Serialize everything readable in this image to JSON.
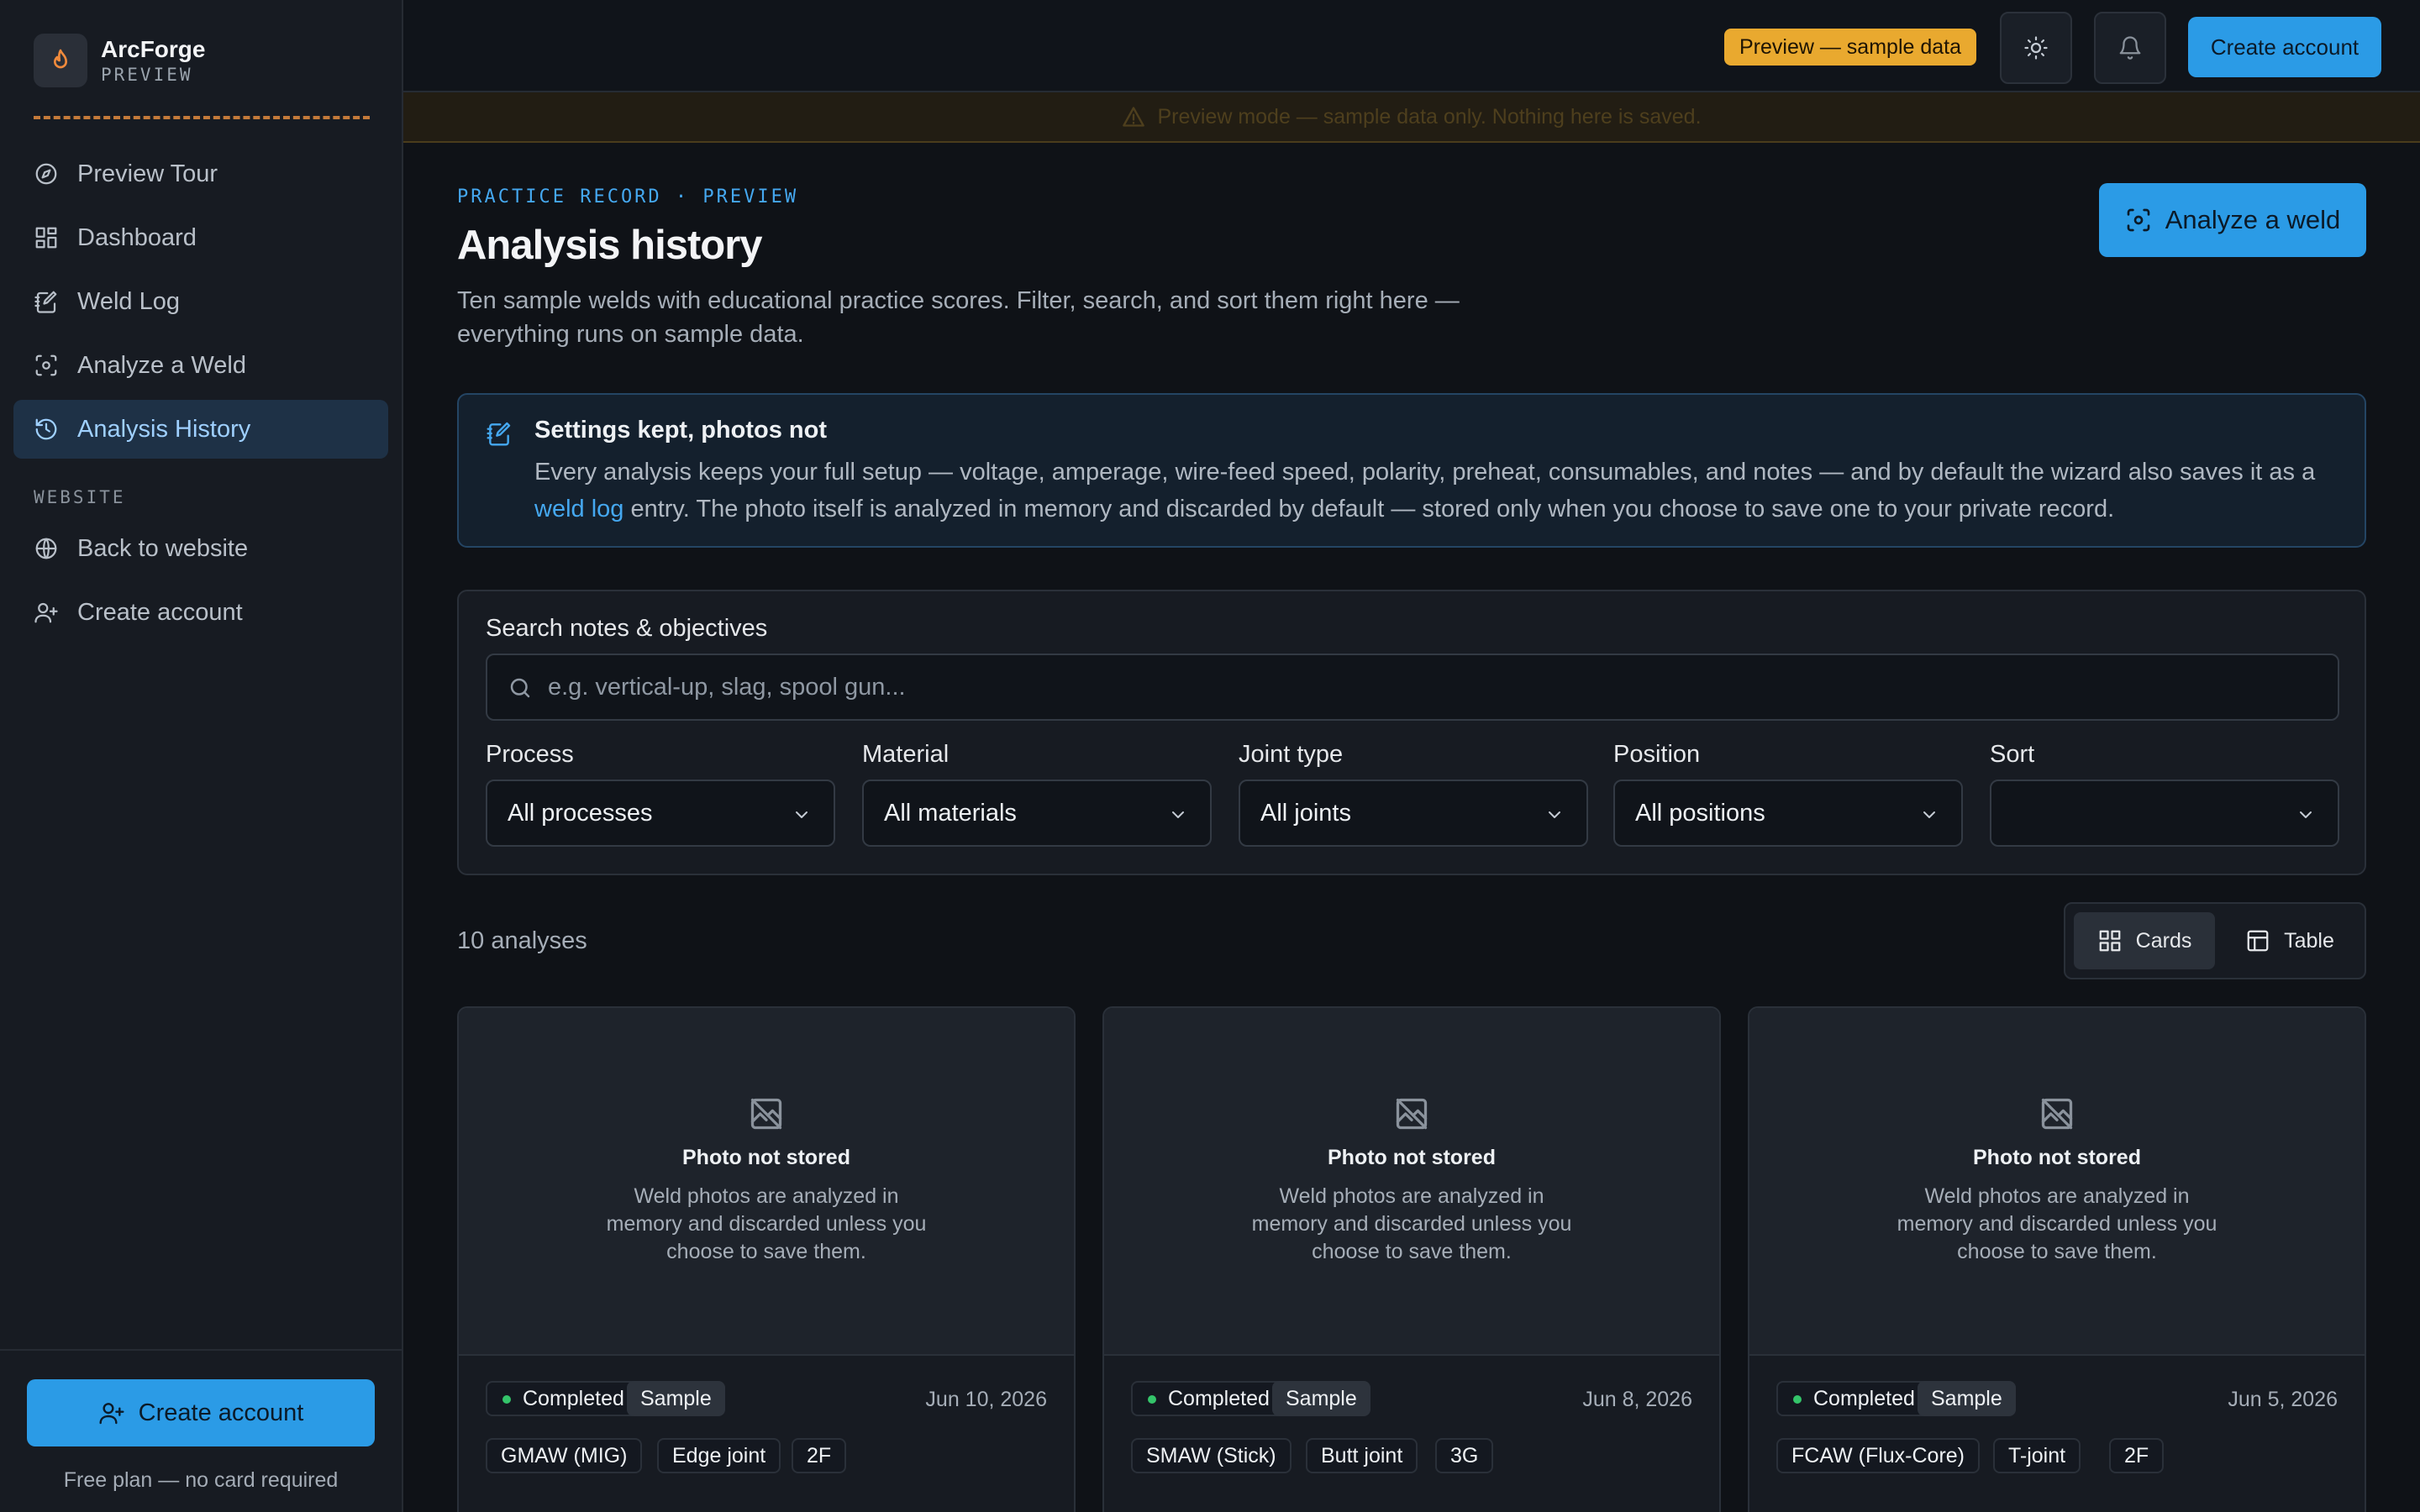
{
  "app": {
    "name": "ArcForge",
    "badge": "PREVIEW"
  },
  "sidebar": {
    "items": [
      {
        "label": "Preview Tour",
        "icon": "compass-icon"
      },
      {
        "label": "Dashboard",
        "icon": "dashboard-icon"
      },
      {
        "label": "Weld Log",
        "icon": "notebook-pen-icon"
      },
      {
        "label": "Analyze a Weld",
        "icon": "scan-icon"
      },
      {
        "label": "Analysis History",
        "icon": "history-icon",
        "active": true
      }
    ],
    "section_label": "WEBSITE",
    "website_items": [
      {
        "label": "Back to website",
        "icon": "globe-icon"
      },
      {
        "label": "Create account",
        "icon": "user-plus-icon"
      }
    ],
    "cta_label": "Create account",
    "cta_note": "Free plan — no card required"
  },
  "topbar": {
    "preview_badge": "Preview — sample data",
    "create_account_label": "Create account"
  },
  "banner": {
    "text": "Preview mode — sample data only. Nothing here is saved."
  },
  "page": {
    "eyebrow": "PRACTICE RECORD · PREVIEW",
    "title": "Analysis history",
    "description": "Ten sample welds with educational practice scores. Filter, search, and sort them right here — everything runs on sample data.",
    "analyze_button": "Analyze a weld"
  },
  "info": {
    "title": "Settings kept, photos not",
    "body_before": "Every analysis keeps your full setup — voltage, amperage, wire-feed speed, polarity, preheat, consumables, and notes — and by default the wizard also saves it as a ",
    "link": "weld log",
    "body_after": " entry. The photo itself is analyzed in memory and discarded by default — stored only when you choose to save one to your private record."
  },
  "filters": {
    "search_label": "Search notes & objectives",
    "search_placeholder": "e.g. vertical-up, slag, spool gun...",
    "search_value": "",
    "process": {
      "label": "Process",
      "value": "All processes"
    },
    "material": {
      "label": "Material",
      "value": "All materials"
    },
    "joint": {
      "label": "Joint type",
      "value": "All joints"
    },
    "position": {
      "label": "Position",
      "value": "All positions"
    },
    "sort": {
      "label": "Sort",
      "value": ""
    }
  },
  "results": {
    "count": "10 analyses",
    "view_cards": "Cards",
    "view_table": "Table",
    "active_view": "Cards"
  },
  "cards": [
    {
      "photo_title": "Photo not stored",
      "photo_text": "Weld photos are analyzed in memory and discarded unless you choose to save them.",
      "status": "Completed",
      "sample": "Sample",
      "date": "Jun 10, 2026",
      "process": "GMAW (MIG)",
      "joint": "Edge joint",
      "position": "2F"
    },
    {
      "photo_title": "Photo not stored",
      "photo_text": "Weld photos are analyzed in memory and discarded unless you choose to save them.",
      "status": "Completed",
      "sample": "Sample",
      "date": "Jun 8, 2026",
      "process": "SMAW (Stick)",
      "joint": "Butt joint",
      "position": "3G"
    },
    {
      "photo_title": "Photo not stored",
      "photo_text": "Weld photos are analyzed in memory and discarded unless you choose to save them.",
      "status": "Completed",
      "sample": "Sample",
      "date": "Jun 5, 2026",
      "process": "FCAW (Flux-Core)",
      "joint": "T-joint",
      "position": "2F"
    }
  ],
  "colors": {
    "accent": "#2b9be6",
    "warning": "#e9a92f",
    "success": "#34c46a",
    "background": "#0f1217"
  }
}
